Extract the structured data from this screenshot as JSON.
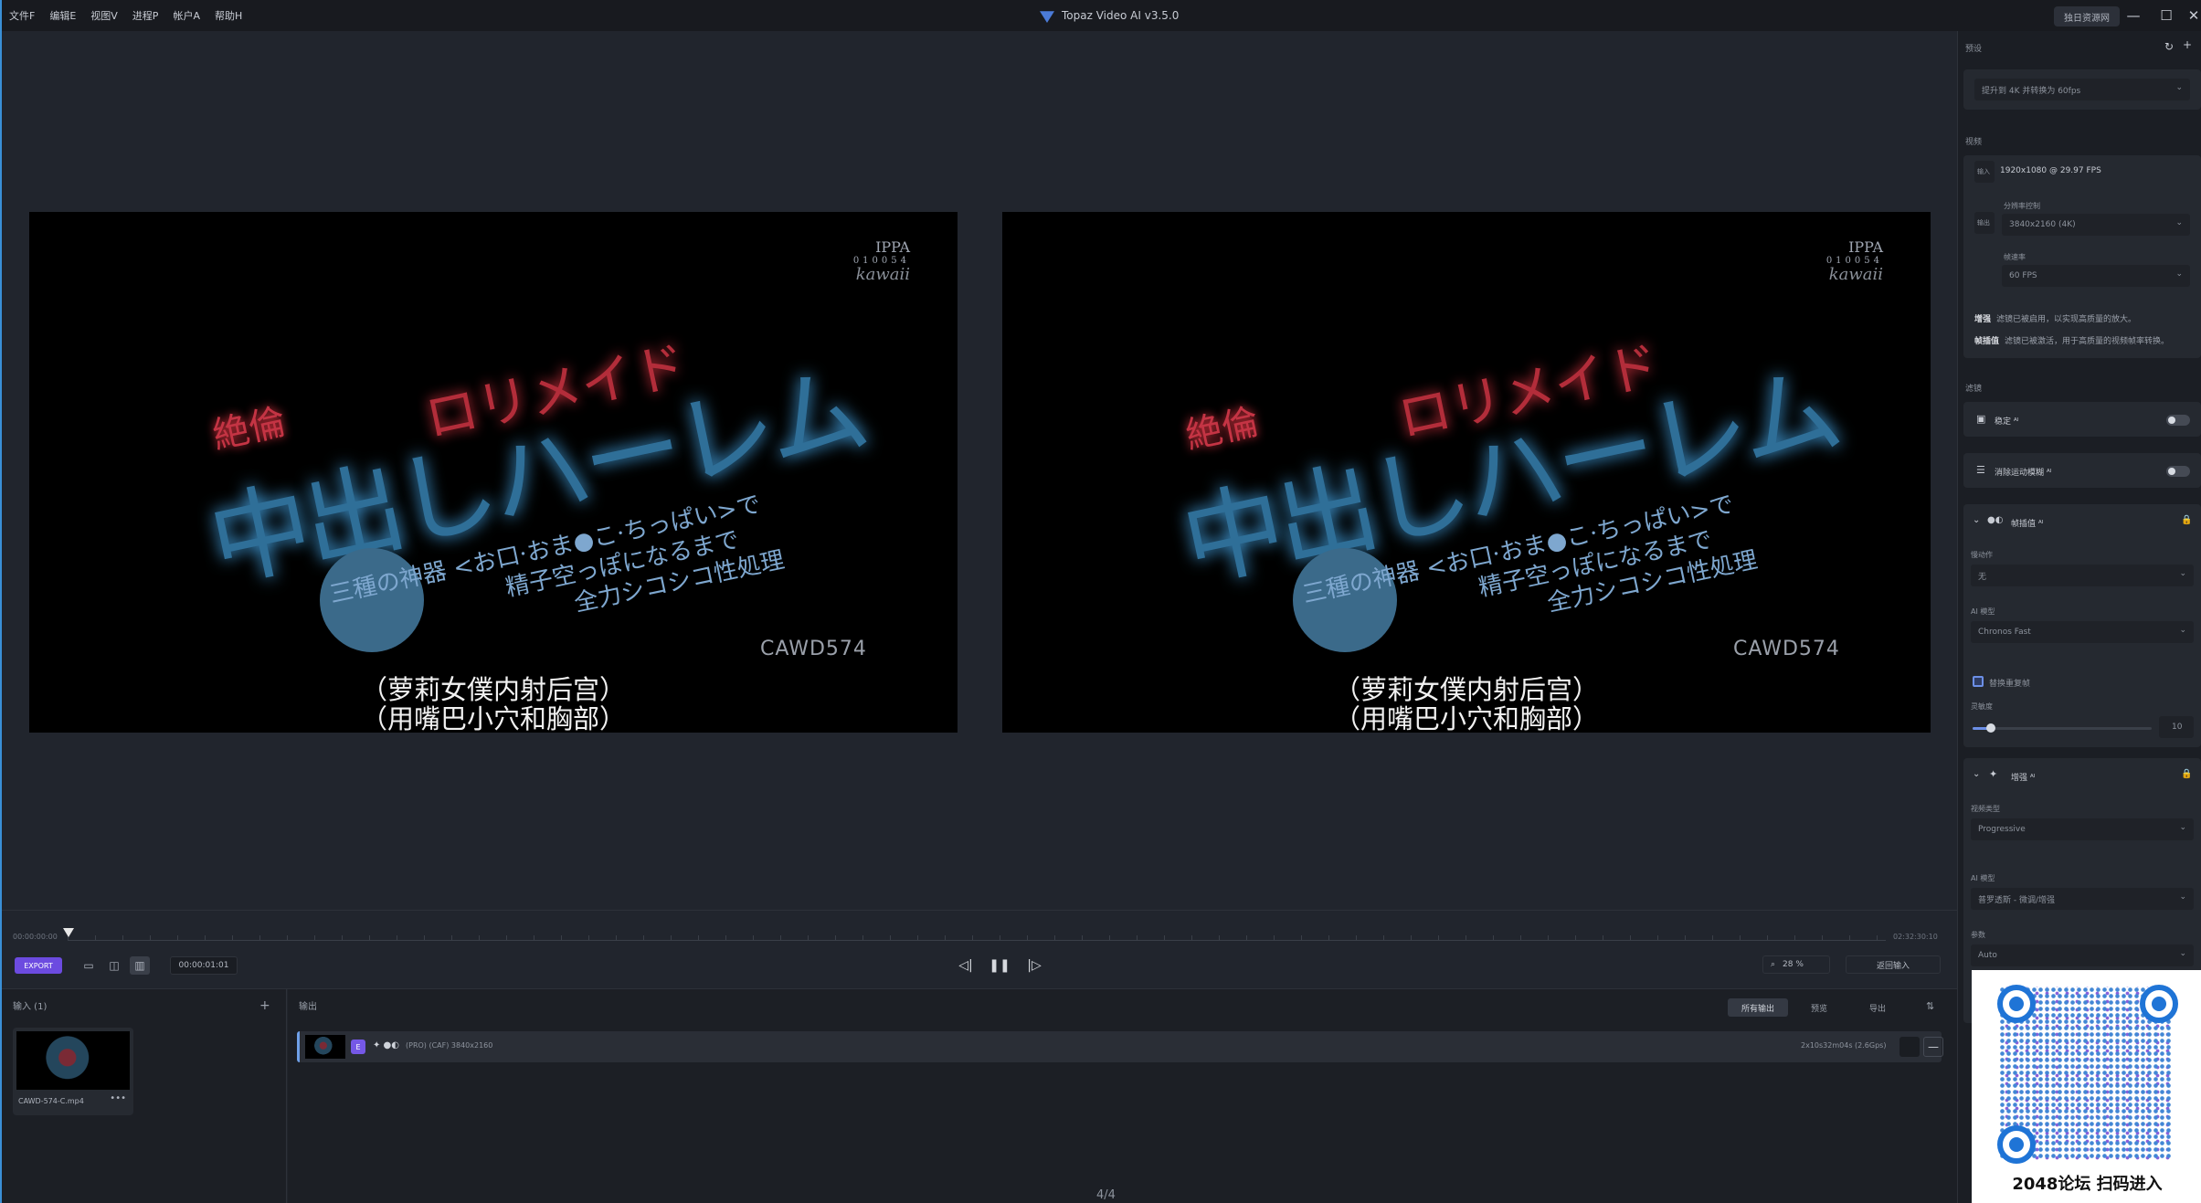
{
  "menu": [
    "文件F",
    "编辑E",
    "视图V",
    "进程P",
    "帐户A",
    "帮助H"
  ],
  "app_title": "Topaz Video AI  v3.5.0",
  "feedback_label": "独日资源网",
  "window_controls": {
    "minimize": "—",
    "maximize": "☐",
    "close": "✕"
  },
  "preview": {
    "ippa": [
      "IPPA",
      "010054",
      "kawaii"
    ],
    "red_title": "ロリメイド",
    "small_red": "絶倫",
    "blue_title": "中出しハーレム",
    "lines": [
      "三種の神器 <お口·おま●こ·ちっぱい>で",
      "精子空っぽになるまで",
      "全力シコシコ性処理"
    ],
    "code": "CAWD574",
    "sub_line1": "（萝莉女僕内射后宫）",
    "sub_line2": "（用嘴巴小穴和胸部）"
  },
  "timeline": {
    "start": "00:00:00:00",
    "end": "02:32:30:10"
  },
  "controls": {
    "export": "EXPORT",
    "timecode": "00:00:01:01",
    "zoom": "28 %",
    "return_input": "返回输入",
    "view_icons": [
      "▭",
      "◫",
      "▥"
    ],
    "prev": "◁|",
    "pause": "❚❚",
    "next": "|▷"
  },
  "input_panel": {
    "title": "输入 (1)",
    "add": "+",
    "file_name": "CAWD-574-C.mp4",
    "more": "•••"
  },
  "output_panel": {
    "title": "输出",
    "tabs": [
      "所有输出",
      "预览",
      "导出"
    ],
    "sort": "⇅",
    "row": {
      "badge": "E",
      "icons": "✦ ●◐",
      "specs": "(PRO) (CAF) 3840x2160",
      "size": "2x10s32m04s (2.6Gps)",
      "minus": "—"
    }
  },
  "page_indicator": "4/4",
  "sidebar": {
    "preset_label": "预设",
    "preset_value": "提升到 4K 并转换为 60fps",
    "video_label": "视频",
    "input_tag": "输入",
    "input_value": "1920x1080 @ 29.97 FPS",
    "output_tag": "输出",
    "resolution_label": "分辨率控制",
    "resolution_value": "3840x2160 (4K)",
    "fps_label": "帧速率",
    "fps_value": "60 FPS",
    "note_enhance_key": "增强",
    "note_enhance": "滤镜已被启用，以实现高质量的放大。",
    "note_interp_key": "帧插值",
    "note_interp": "滤镜已被激活，用于高质量的视频帧率转换。",
    "filters_label": "滤镜",
    "stabilize": "稳定 ᴬᴵ",
    "motion_blur": "消除运动模糊 ᴬᴵ",
    "interp_title": "帧插值 ᴬᴵ",
    "slowmo_label": "慢动作",
    "slowmo_value": "无",
    "ai_model_label": "AI 模型",
    "interp_model_value": "Chronos Fast",
    "dup_frames": "替换重复帧",
    "sensitivity_label": "灵敏度",
    "sensitivity_value": "10",
    "enhance_title": "增强 ᴬᴵ",
    "video_type_label": "视频类型",
    "video_type_value": "Progressive",
    "enhance_model_value": "普罗透斯 - 微调/增强",
    "params_label": "参数",
    "params_value": "Auto",
    "chevron": "⌄",
    "collapse": "⌄",
    "lock": "🔒",
    "reset_icon": "↻",
    "add_icon": "+"
  },
  "qr_caption": "2048论坛 扫码进入"
}
